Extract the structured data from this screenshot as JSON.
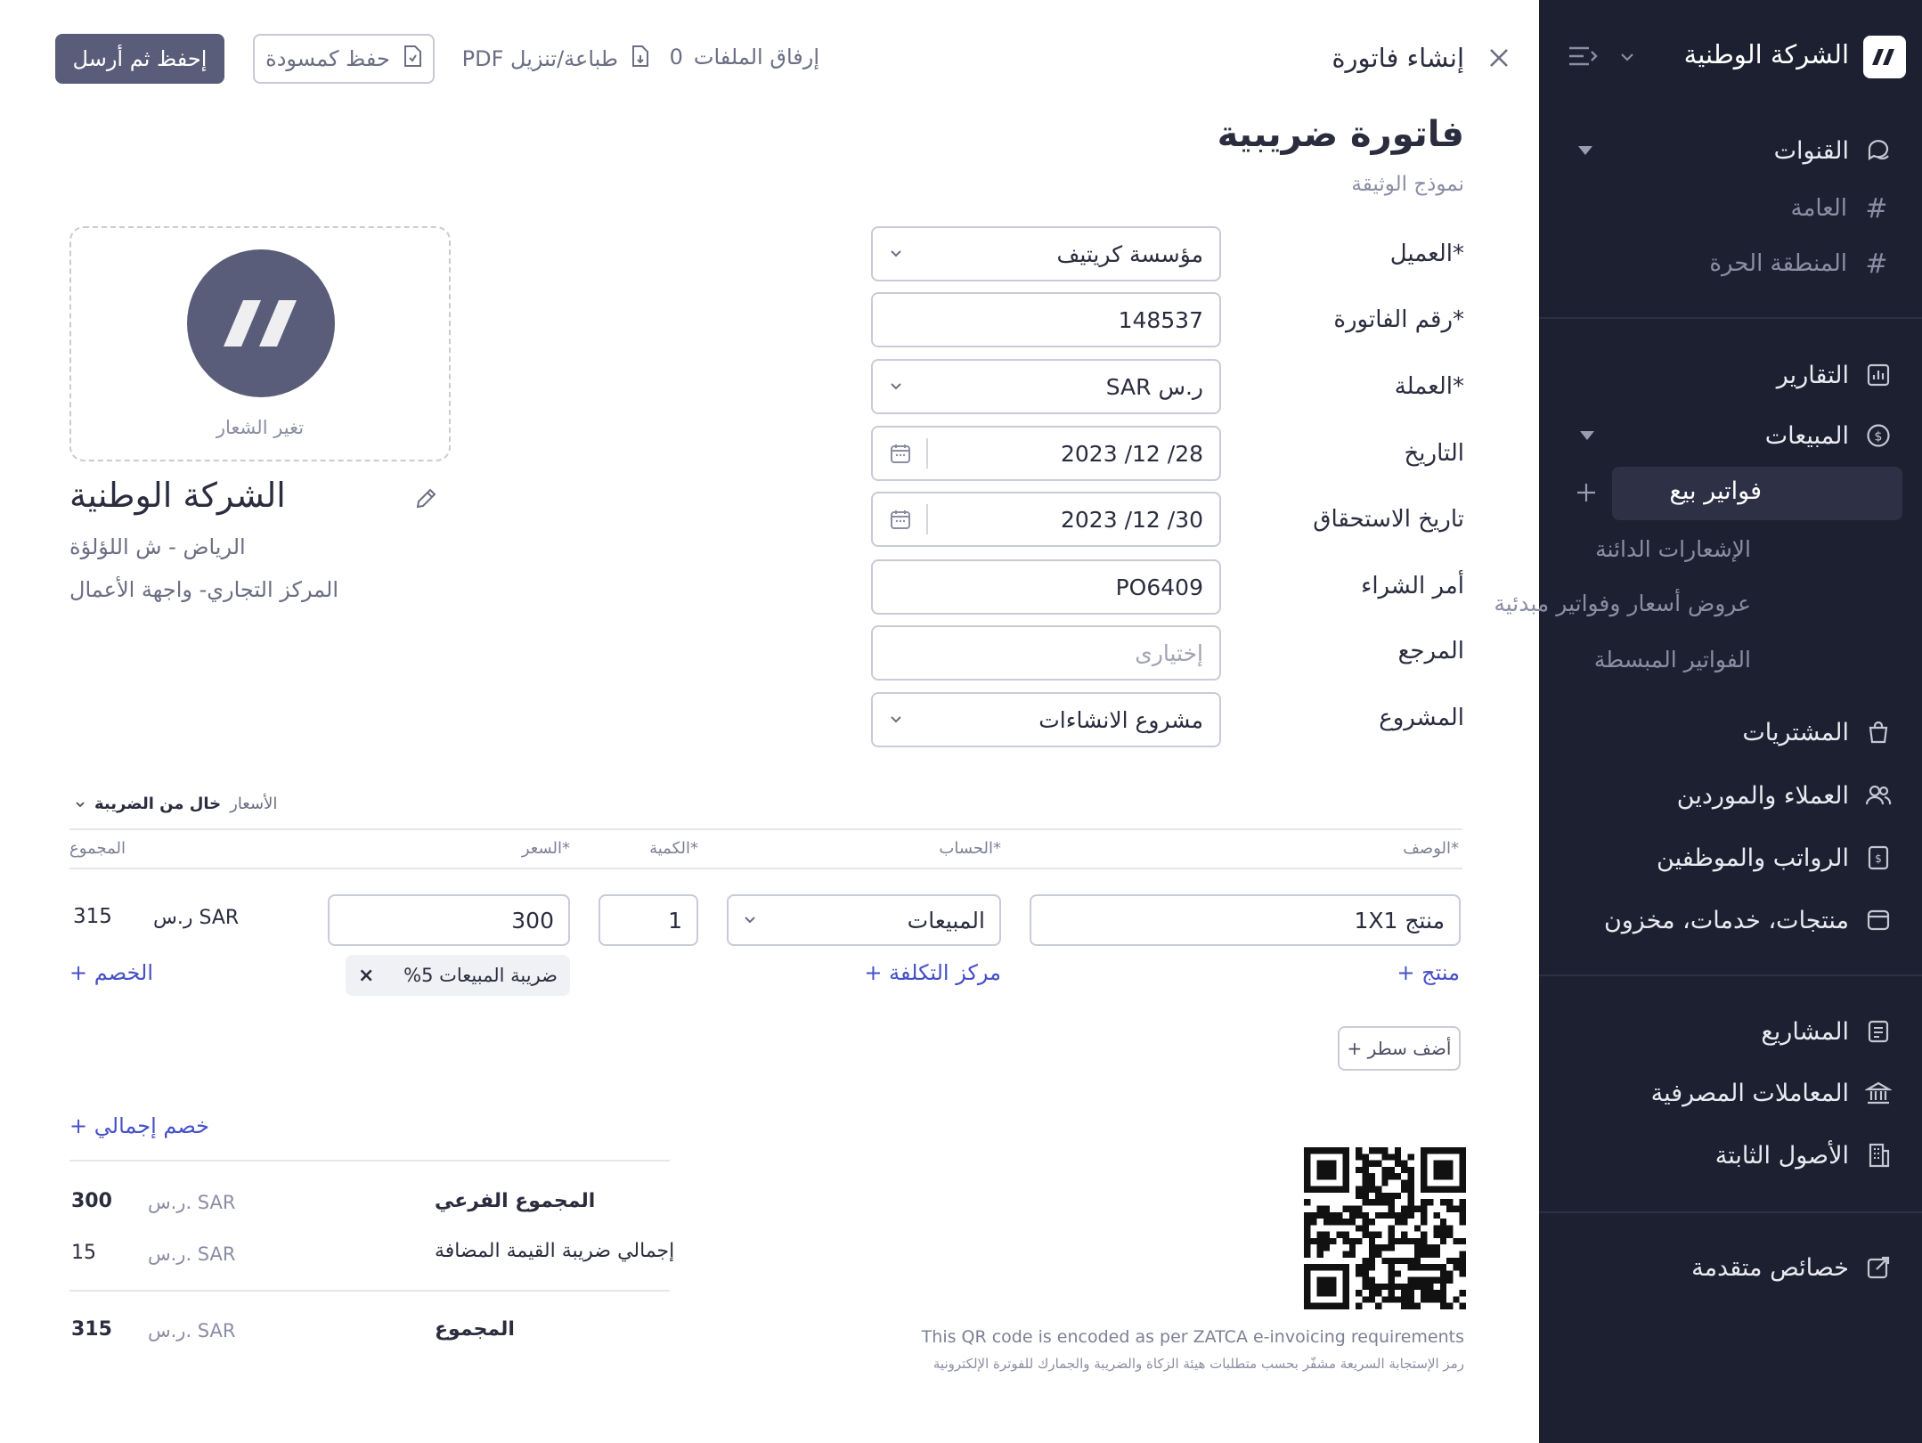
{
  "sidebar": {
    "company_name": "الشركة الوطنية",
    "logo_text": "//",
    "sections": [
      {
        "label": "القنوات"
      },
      {
        "label": "التقارير"
      },
      {
        "label": "المبيعات"
      },
      {
        "label": "المشتريات"
      },
      {
        "label": "العملاء والموردين"
      },
      {
        "label": "الرواتب والموظفين"
      },
      {
        "label": "منتجات، خدمات، مخزون"
      },
      {
        "label": "المشاريع"
      },
      {
        "label": "المعاملات المصرفية"
      },
      {
        "label": "الأصول الثابتة"
      },
      {
        "label": "خصائص متقدمة"
      }
    ],
    "channels": [
      {
        "label": "العامة"
      },
      {
        "label": "المنطقة الحرة"
      }
    ],
    "sales_items": [
      {
        "label": "فواتير بيع"
      },
      {
        "label": "الإشعارات الدائنة"
      },
      {
        "label": "عروض أسعار وفواتير مبدئية"
      },
      {
        "label": "الفواتير المبسطة"
      }
    ]
  },
  "topbar": {
    "title": "إنشاء فاتورة",
    "attach_label": "إرفاق الملفات",
    "attach_count": "0",
    "print_label": "طباعة/تنزيل PDF",
    "draft_label": "حفظ كمسودة",
    "send_label": "إحفظ ثم أرسل"
  },
  "doc": {
    "title": "فاتورة ضريبية",
    "subtitle": "نموذج الوثيقة"
  },
  "form": {
    "client_label": "العميل*",
    "client_value": "مؤسسة كريتيف",
    "invoice_no_label": "رقم الفاتورة*",
    "invoice_no_value": "148537",
    "currency_label": "العملة*",
    "currency_value": "ر.س SAR",
    "date_label": "التاريخ",
    "date_value": "28/ 12/ 2023",
    "due_label": "تاريخ الاستحقاق",
    "due_value": "30/ 12/ 2023",
    "po_label": "أمر الشراء",
    "po_value": "PO6409",
    "ref_label": "المرجع",
    "ref_placeholder": "إختيارى",
    "project_label": "المشروع",
    "project_value": "مشروع الانشاءات"
  },
  "company": {
    "change_logo": "تغير الشعار",
    "name": "الشركة الوطنية",
    "address1": "الرياض - ش اللؤلؤة",
    "address2": "المركز التجاري- واجهة الأعمال"
  },
  "prices_toggle": {
    "prefix": "الأسعار",
    "value": "خال من الضريبة"
  },
  "table": {
    "headers": {
      "description": "الوصف*",
      "account": "الحساب*",
      "quantity": "الكمية*",
      "price": "السعر*",
      "total": "المجموع"
    },
    "row": {
      "description": "منتج 1X1",
      "account": "المبيعات",
      "quantity": "1",
      "price": "300",
      "currency": "ر.س SAR",
      "total": "315",
      "tax_chip": "ضريبة المبيعات 5%",
      "tax_remove": "×",
      "add_product": "+ منتج",
      "add_cost_center": "+ مركز التكلفة",
      "add_discount": "+ الخصم"
    },
    "add_row": "+ أضف سطر"
  },
  "totals": {
    "global_discount": "+ خصم إجمالي",
    "subtotal_label": "المجموع الفرعي",
    "subtotal_value": "300",
    "vat_label": "إجمالي ضريبة القيمة المضافة",
    "vat_value": "15",
    "total_label": "المجموع",
    "total_value": "315",
    "currency": "ر.س. SAR"
  },
  "qr": {
    "note_en": "This QR code is encoded as per ZATCA e-invoicing requirements",
    "note_ar": "رمز الإستجابة السريعة مشفّر بحسب متطلبات هيئة الزكاة والضريبة والجمارك للفوترة الإلكترونية"
  },
  "colors": {
    "sidebar_bg": "#1d2030",
    "sidebar_active": "#2e3146",
    "primary": "#5a5d79",
    "link": "#4650c8",
    "border": "#c9cbd6"
  }
}
